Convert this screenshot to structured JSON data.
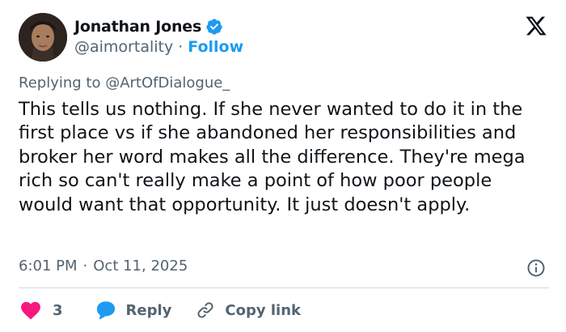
{
  "author": {
    "name": "Jonathan Jones",
    "handle": "@aimortality",
    "separator": "·",
    "follow_label": "Follow",
    "verified": true
  },
  "post": {
    "replying_prefix": "Replying to",
    "replying_to": "@ArtOfDialogue_",
    "text": "This tells us nothing. If she never wanted to do it in the first place vs if she abandoned her responsibilities and broker her word makes all the difference. They're mega rich so can't really make a point of how poor people would want that opportunity. It just doesn't apply.",
    "time": "6:01 PM",
    "date_separator": "·",
    "date": "Oct 11, 2025"
  },
  "actions": {
    "like_count": "3",
    "reply_label": "Reply",
    "copy_link_label": "Copy link"
  },
  "colors": {
    "accent": "#1d9bf0",
    "like": "#f91880",
    "text": "#0f1419",
    "muted": "#536471",
    "divider": "#cfd9de"
  },
  "icons": [
    "verified-badge-icon",
    "x-logo-icon",
    "info-icon",
    "heart-icon",
    "reply-bubble-icon",
    "link-icon"
  ]
}
